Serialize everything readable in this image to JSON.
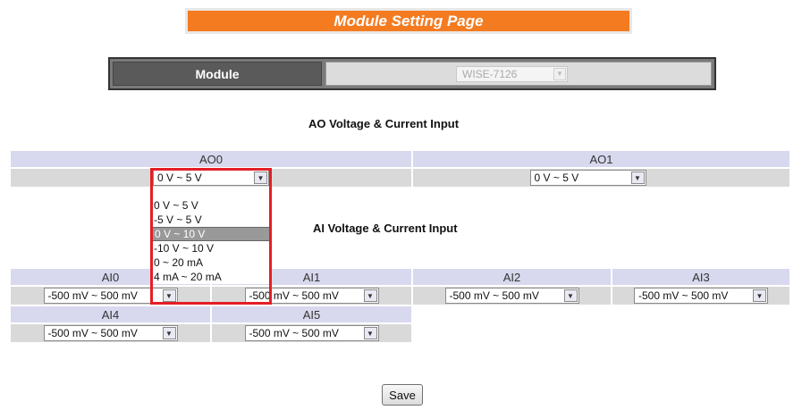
{
  "page_title": "Module Setting Page",
  "module": {
    "label": "Module",
    "value": "WISE-7126"
  },
  "ao_section": {
    "title": "AO Voltage & Current Input",
    "channels": [
      {
        "name": "AO0",
        "value": "0 V ~ 5 V"
      },
      {
        "name": "AO1",
        "value": "0 V ~ 5 V"
      }
    ],
    "dropdown_options": [
      "0 V ~ 5 V",
      "-5 V ~ 5 V",
      "0 V ~ 10 V",
      "-10 V ~ 10 V",
      "0 ~ 20 mA",
      "4 mA ~ 20 mA"
    ],
    "highlighted_option": "0 V ~ 10 V"
  },
  "ai_section": {
    "title": "AI Voltage & Current Input",
    "channels": [
      {
        "name": "AI0",
        "value": "-500 mV ~ 500 mV"
      },
      {
        "name": "AI1",
        "value": "-500 mV ~ 500 mV"
      },
      {
        "name": "AI2",
        "value": "-500 mV ~ 500 mV"
      },
      {
        "name": "AI3",
        "value": "-500 mV ~ 500 mV"
      },
      {
        "name": "AI4",
        "value": "-500 mV ~ 500 mV"
      },
      {
        "name": "AI5",
        "value": "-500 mV ~ 500 mV"
      }
    ]
  },
  "save_label": "Save",
  "colors": {
    "title_bg": "#f47b20",
    "highlight_border": "#e41e26",
    "header_bg": "#d8d8ee",
    "value_bg": "#d9d9d9"
  }
}
